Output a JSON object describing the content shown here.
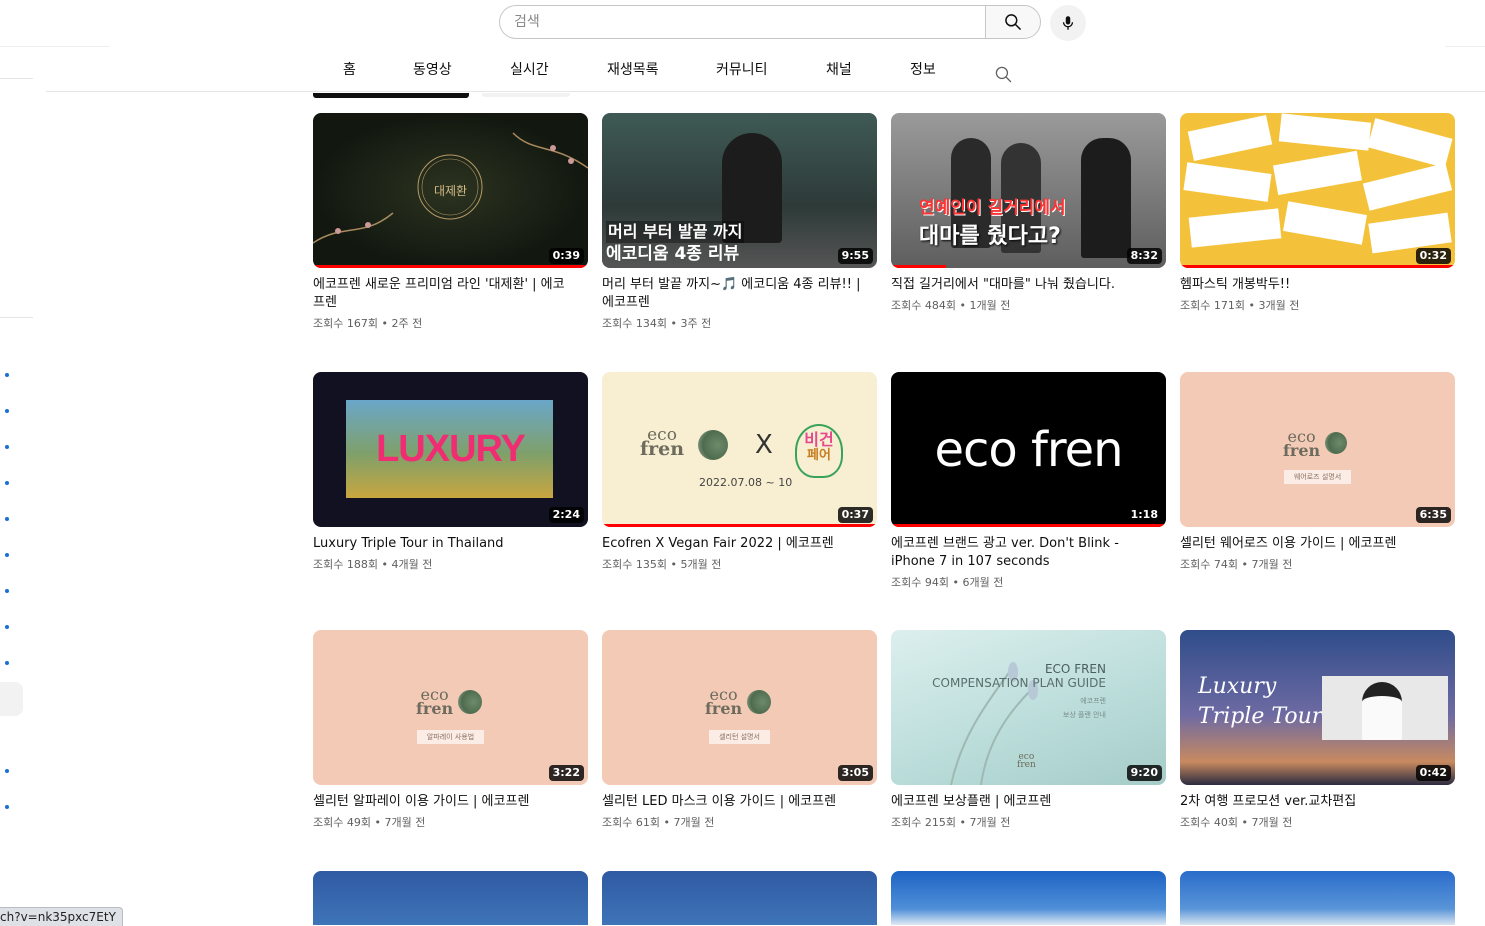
{
  "search": {
    "placeholder": "검색",
    "icon": "search-icon",
    "mic_icon": "mic-icon"
  },
  "tabs": [
    {
      "label": "홈"
    },
    {
      "label": "동영상"
    },
    {
      "label": "실시간"
    },
    {
      "label": "재생목록"
    },
    {
      "label": "커뮤니티"
    },
    {
      "label": "채널"
    },
    {
      "label": "정보"
    }
  ],
  "tab_search_icon": "search-icon",
  "active_tab": "동영상",
  "status_url": "ch?v=nk35pxc7EtY",
  "colors": {
    "accent_blue": "#1a6fd6",
    "progress_red": "#ff0000",
    "meta_gray": "#606060"
  },
  "videos": [
    {
      "title": "에코프렌 새로운 프리미엄 라인 '대제환' | 에코프렌",
      "meta": "조회수 167회 • 2주 전",
      "duration": "0:39",
      "progress": 1.0,
      "thumb_text": [
        "대제환"
      ]
    },
    {
      "title": "머리 부터 발끝 까지~🎵 에코디움 4종 리뷰!! | 에코프렌",
      "meta": "조회수 134회 • 3주 전",
      "duration": "9:55",
      "progress": 0.0,
      "thumb_text": [
        "머리 부터 발끝 까지",
        "에코디움 4종 리뷰"
      ]
    },
    {
      "title": "직접 길거리에서 \"대마를\" 나눠 줬습니다.",
      "meta": "조회수 484회 • 1개월 전",
      "duration": "8:32",
      "progress": 0.2,
      "thumb_text": [
        "연예인이 길거리에서",
        "대마를 줬다고?"
      ]
    },
    {
      "title": "헴파스틱 개봉박두!!",
      "meta": "조회수 171회 • 3개월 전",
      "duration": "0:32",
      "progress": 1.0,
      "thumb_text": []
    },
    {
      "title": "Luxury Triple Tour in Thailand",
      "meta": "조회수 188회 • 4개월 전",
      "duration": "2:24",
      "progress": 0.0,
      "thumb_text": [
        "LUXURY"
      ]
    },
    {
      "title": "Ecofren X Vegan Fair 2022 | 에코프렌",
      "meta": "조회수 135회 • 5개월 전",
      "duration": "0:37",
      "progress": 1.0,
      "thumb_text": [
        "eco",
        "fren",
        "X",
        "비건",
        "페어",
        "2022.07.08 ~ 10"
      ]
    },
    {
      "title": "에코프렌 브랜드 광고 ver. Don't Blink - iPhone 7 in 107 seconds",
      "meta": "조회수 94회 • 6개월 전",
      "duration": "1:18",
      "progress": 1.0,
      "thumb_text": [
        "eco fren"
      ]
    },
    {
      "title": "셀리턴 웨어로즈 이용 가이드 | 에코프렌",
      "meta": "조회수 74회 • 7개월 전",
      "duration": "6:35",
      "progress": 0.0,
      "thumb_text": [
        "eco",
        "fren",
        "웨어로즈 설명서"
      ]
    },
    {
      "title": "셀리턴 알파레이 이용 가이드 | 에코프렌",
      "meta": "조회수 49회 • 7개월 전",
      "duration": "3:22",
      "progress": 0.0,
      "thumb_text": [
        "eco",
        "fren",
        "알파레이 사용법"
      ]
    },
    {
      "title": "셀리턴 LED 마스크 이용 가이드 | 에코프렌",
      "meta": "조회수 61회 • 7개월 전",
      "duration": "3:05",
      "progress": 0.0,
      "thumb_text": [
        "eco",
        "fren",
        "셀리턴 설명서"
      ]
    },
    {
      "title": "에코프렌 보상플랜 | 에코프렌",
      "meta": "조회수 215회 • 7개월 전",
      "duration": "9:20",
      "progress": 0.0,
      "thumb_text": [
        "ECO FREN",
        "COMPENSATION PLAN GUIDE",
        "에코프렌",
        "보상 플랜 안내",
        "eco",
        "fren"
      ]
    },
    {
      "title": "2차 여행 프로모션 ver.교차편집",
      "meta": "조회수 40회 • 7개월 전",
      "duration": "0:42",
      "progress": 0.0,
      "thumb_text": [
        "Luxury",
        "Triple Tour"
      ]
    }
  ]
}
